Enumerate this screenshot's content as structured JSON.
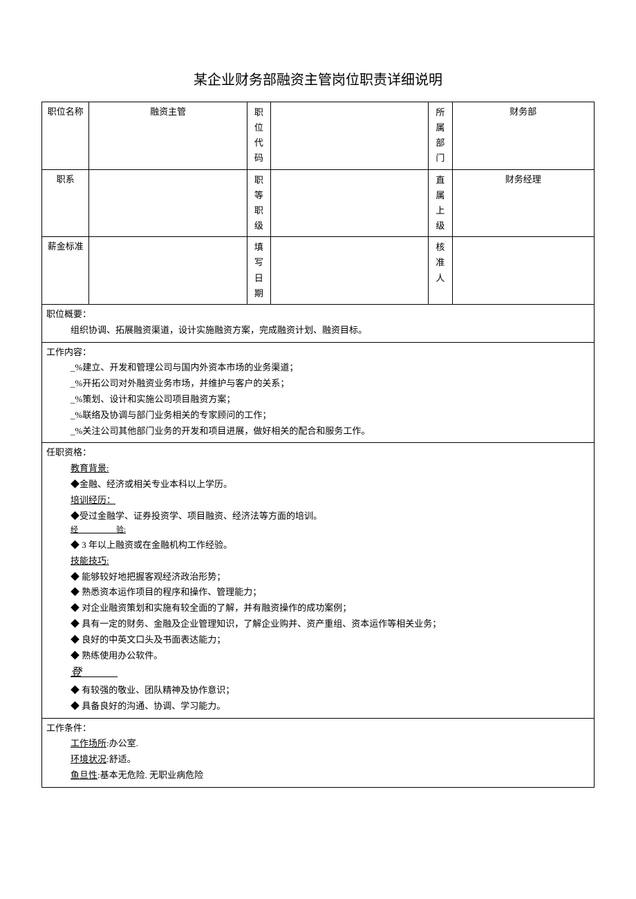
{
  "title": "某企业财务部融资主管岗位职责详细说明",
  "header": {
    "row1": {
      "label1": "职位名称",
      "value1": "融资主管",
      "label2": "职位代码",
      "value2": "",
      "label3": "所属部门",
      "value3": "财务部"
    },
    "row2": {
      "label1": "职系",
      "value1": "",
      "label2": "职等职级",
      "value2": "",
      "label3": "直属上级",
      "value3": "财务经理"
    },
    "row3": {
      "label1": "薪金标准",
      "value1": "",
      "label2": "填写日期",
      "value2": "",
      "label3": "核准人",
      "value3": ""
    }
  },
  "sections": {
    "overview": {
      "heading": "职位概要：",
      "content": "组织协调、拓展融资渠道，设计实施融资方案，完成融资计划、融资目标。"
    },
    "work_content": {
      "heading": "工作内容：",
      "items": [
        "_%建立、开发和管理公司与国内外资本市场的业务渠道；",
        "_%开拓公司对外融资业务市场，并维护与客户的关系；",
        "_%策划、设计和实施公司项目融资方案；",
        "_%联络及协调与部门业务相关的专家顾问的工作；",
        "_%关注公司其他部门业务的开发和项目进展，做好相关的配合和服务工作。"
      ]
    },
    "qualifications": {
      "heading": "任职资格：",
      "edu_label": "教育背景:",
      "edu_item": "◆金融、经济或相关专业本科以上学历。",
      "training_label": "培训经历：",
      "training_item": "◆受过金融学、证券投资学、项目融资、经济法等方面的培训。",
      "exp_label": "经　　　　　验:",
      "exp_item": "◆ 3 年以上融资或在金融机构工作经验。",
      "skills_label": "技能技巧:",
      "skills_items": [
        "◆ 能够较好地把握客观经济政治形势；",
        "◆ 熟悉资本运作项目的程序和操作、管理能力；",
        "◆ 对企业融资策划和实施有较全面的了解，并有融资操作的成功案例；",
        "◆ 具有一定的财务、金融及企业管理知识，了解企业购并、资产重组、资本运作等相关业务；",
        "◆ 良好的中英文口头及书面表达能力；",
        "◆ 熟练使用办公软件。"
      ],
      "attitude_label": "登 ______",
      "attitude_items": [
        "◆ 有较强的敬业、团队精神及协作意识；",
        "◆ 具备良好的沟通、协调、学习能力。"
      ]
    },
    "conditions": {
      "heading": "工作条件：",
      "place_label": "工作场所",
      "place_value": ":办公室.",
      "env_label": "环境状况",
      "env_value": ":舒适。",
      "risk_label": "鱼旦性",
      "risk_value": ":基本无危险. 无职业病危险"
    }
  }
}
